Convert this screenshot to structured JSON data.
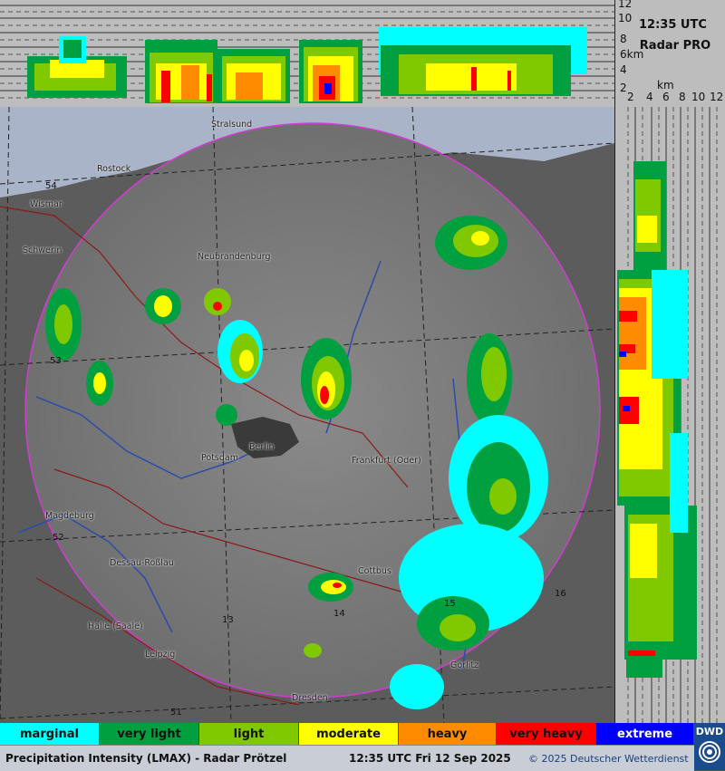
{
  "time_label": "12:35 UTC",
  "product_label": "Radar PRO",
  "height_axis": {
    "unit": "km",
    "ticks": [
      "12",
      "10",
      "8",
      "6",
      "4",
      "2"
    ],
    "unit_label_top": "6km"
  },
  "distance_axis": {
    "unit": "km",
    "ticks": [
      "2",
      "4",
      "6",
      "8",
      "10",
      "12"
    ]
  },
  "cities": [
    {
      "name": "Stralsund"
    },
    {
      "name": "Rostock"
    },
    {
      "name": "Wismar"
    },
    {
      "name": "Schwerin"
    },
    {
      "name": "Neubrandenburg"
    },
    {
      "name": "Berlin"
    },
    {
      "name": "Potsdam"
    },
    {
      "name": "Frankfurt (Oder)"
    },
    {
      "name": "Magdeburg"
    },
    {
      "name": "Dessau-Roßlau"
    },
    {
      "name": "Cottbus"
    },
    {
      "name": "Halle (Saale)"
    },
    {
      "name": "Leipzig"
    },
    {
      "name": "Görlitz"
    },
    {
      "name": "Dresden"
    }
  ],
  "grid_numbers": [
    "54",
    "53",
    "52",
    "51",
    "13",
    "14",
    "15",
    "16"
  ],
  "legend": [
    {
      "label": "marginal",
      "color": "#00ffff"
    },
    {
      "label": "very light",
      "color": "#00a040"
    },
    {
      "label": "light",
      "color": "#80c800"
    },
    {
      "label": "moderate",
      "color": "#ffff00"
    },
    {
      "label": "heavy",
      "color": "#ff8c00"
    },
    {
      "label": "very heavy",
      "color": "#ff0000"
    },
    {
      "label": "extreme",
      "color": "#0000ff"
    }
  ],
  "footer": {
    "title": "Precipitation Intensity (LMAX) - Radar Prötzel",
    "timestamp": "12:35 UTC Fri 12 Sep 2025",
    "copyright": "© 2025 Deutscher Wetterdienst"
  },
  "logo": {
    "text": "DWD"
  },
  "colors": {
    "range_ring": "#d23cd2",
    "water": "#aab4c8",
    "land": "#808080",
    "river": "#2040a0",
    "border": "#8b1a1a"
  }
}
